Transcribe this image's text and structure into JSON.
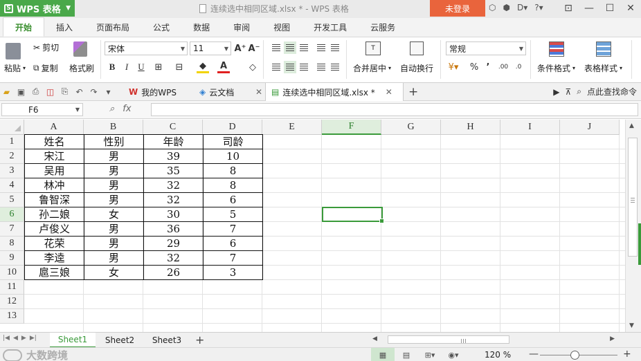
{
  "titlebar": {
    "app_name": "WPS 表格",
    "doc_title": "连续选中相同区域.xlsx * - WPS 表格",
    "login": "未登录",
    "help": "?"
  },
  "ribbon_tabs": [
    "开始",
    "插入",
    "页面布局",
    "公式",
    "数据",
    "审阅",
    "视图",
    "开发工具",
    "云服务"
  ],
  "ribbon": {
    "paste": "粘贴",
    "cut": "剪切",
    "copy": "复制",
    "format_painter": "格式刷",
    "font_name": "宋体",
    "font_size": "11",
    "bold": "B",
    "italic": "I",
    "underline": "U",
    "font_color_letter": "A",
    "merge_center": "合并居中",
    "wrap_text": "自动换行",
    "number_format": "常规",
    "percent": "%",
    "comma": "’",
    "cond_format": "条件格式",
    "table_style": "表格样式"
  },
  "doc_tabs": [
    {
      "label": "我的WPS"
    },
    {
      "label": "云文档"
    },
    {
      "label": "连续选中相同区域.xlsx *"
    }
  ],
  "find_command": "点此查找命令",
  "formula_bar": {
    "cell_ref": "F6",
    "fx": "fx",
    "content": ""
  },
  "columns": [
    "A",
    "B",
    "C",
    "D",
    "E",
    "F",
    "G",
    "H",
    "I",
    "J"
  ],
  "selected_column": "F",
  "rows": [
    "1",
    "2",
    "3",
    "4",
    "5",
    "6",
    "7",
    "8",
    "9",
    "10",
    "11",
    "12",
    "13"
  ],
  "selected_row": "6",
  "table": {
    "headers": [
      "姓名",
      "性别",
      "年龄",
      "司龄"
    ],
    "rows": [
      [
        "宋江",
        "男",
        "39",
        "10"
      ],
      [
        "吴用",
        "男",
        "35",
        "8"
      ],
      [
        "林冲",
        "男",
        "32",
        "8"
      ],
      [
        "鲁智深",
        "男",
        "32",
        "6"
      ],
      [
        "孙二娘",
        "女",
        "30",
        "5"
      ],
      [
        "卢俊义",
        "男",
        "36",
        "7"
      ],
      [
        "花荣",
        "男",
        "29",
        "6"
      ],
      [
        "李逵",
        "男",
        "32",
        "7"
      ],
      [
        "扈三娘",
        "女",
        "26",
        "3"
      ]
    ]
  },
  "sheets": [
    "Sheet1",
    "Sheet2",
    "Sheet3"
  ],
  "active_sheet": "Sheet1",
  "status": {
    "watermark": "大数跨境",
    "zoom": "120 %"
  },
  "colors": {
    "accent": "#3a9a3a",
    "app_green": "#4aa84a",
    "login_orange": "#e9643c"
  }
}
